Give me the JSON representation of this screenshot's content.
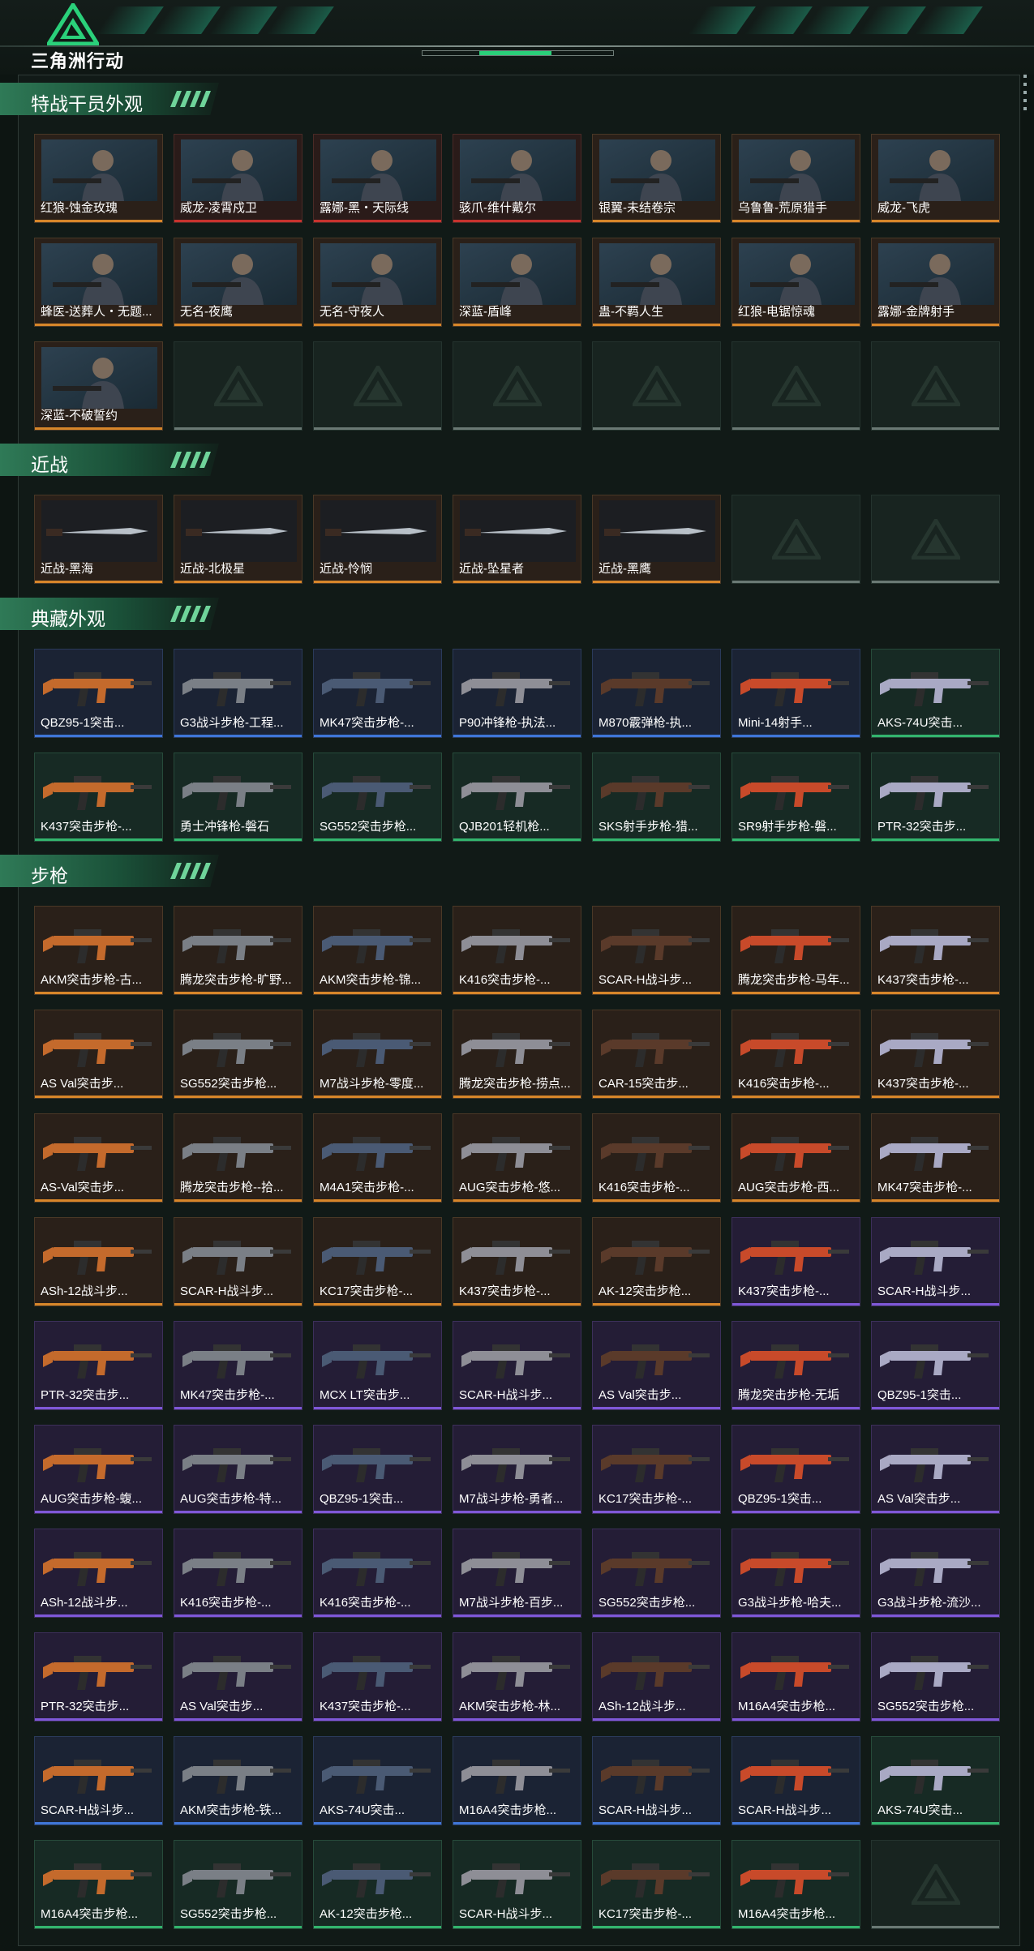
{
  "header": {
    "logo_text": "三角洲行动",
    "progress_fraction": 0.38
  },
  "colors": {
    "accent_green": "#2ad07a",
    "orange": "#d8862a",
    "purple": "#7f58d8",
    "blue": "#3f76d8",
    "green": "#33b56e",
    "red": "#c8322e",
    "gold": "#d6a33a",
    "empty": "#6a7974"
  },
  "sections": [
    {
      "title": "特战干员外观",
      "items": [
        {
          "name": "红狼-蚀金玫瑰",
          "rarity": "orange",
          "type": "operator"
        },
        {
          "name": "威龙-凌霄戍卫",
          "rarity": "red",
          "type": "operator"
        },
        {
          "name": "露娜-黑・天际线",
          "rarity": "red",
          "type": "operator"
        },
        {
          "name": "骇爪-维什戴尔",
          "rarity": "red",
          "type": "operator"
        },
        {
          "name": "银翼-未结卷宗",
          "rarity": "orange",
          "type": "operator"
        },
        {
          "name": "乌鲁鲁-荒原猎手",
          "rarity": "orange",
          "type": "operator"
        },
        {
          "name": "威龙-飞虎",
          "rarity": "orange",
          "type": "operator"
        },
        {
          "name": "蜂医-送葬人・无题...",
          "rarity": "orange",
          "type": "operator"
        },
        {
          "name": "无名-夜鹰",
          "rarity": "orange",
          "type": "operator"
        },
        {
          "name": "无名-守夜人",
          "rarity": "orange",
          "type": "operator"
        },
        {
          "name": "深蓝-盾峰",
          "rarity": "orange",
          "type": "operator"
        },
        {
          "name": "蛊-不羁人生",
          "rarity": "orange",
          "type": "operator"
        },
        {
          "name": "红狼-电锯惊魂",
          "rarity": "orange",
          "type": "operator"
        },
        {
          "name": "露娜-金牌射手",
          "rarity": "orange",
          "type": "operator"
        },
        {
          "name": "深蓝-不破誓约",
          "rarity": "orange",
          "type": "operator"
        },
        {
          "name": "",
          "rarity": "empty"
        },
        {
          "name": "",
          "rarity": "empty"
        },
        {
          "name": "",
          "rarity": "empty"
        },
        {
          "name": "",
          "rarity": "empty"
        },
        {
          "name": "",
          "rarity": "empty"
        },
        {
          "name": "",
          "rarity": "empty"
        }
      ]
    },
    {
      "title": "近战",
      "items": [
        {
          "name": "近战-黑海",
          "rarity": "orange",
          "type": "melee"
        },
        {
          "name": "近战-北极星",
          "rarity": "orange",
          "type": "melee"
        },
        {
          "name": "近战-怜悯",
          "rarity": "orange",
          "type": "melee"
        },
        {
          "name": "近战-坠星者",
          "rarity": "orange",
          "type": "melee"
        },
        {
          "name": "近战-黑鹰",
          "rarity": "orange",
          "type": "melee"
        },
        {
          "name": "",
          "rarity": "empty"
        },
        {
          "name": "",
          "rarity": "empty"
        }
      ]
    },
    {
      "title": "典藏外观",
      "items": [
        {
          "name": "QBZ95-1突击...",
          "rarity": "blue",
          "type": "gun"
        },
        {
          "name": "G3战斗步枪-工程...",
          "rarity": "blue",
          "type": "gun"
        },
        {
          "name": "MK47突击步枪-...",
          "rarity": "blue",
          "type": "gun"
        },
        {
          "name": "P90冲锋枪-执法...",
          "rarity": "blue",
          "type": "gun"
        },
        {
          "name": "M870霰弹枪-执...",
          "rarity": "blue",
          "type": "gun"
        },
        {
          "name": "Mini-14射手...",
          "rarity": "blue",
          "type": "gun"
        },
        {
          "name": "AKS-74U突击...",
          "rarity": "green",
          "type": "gun"
        },
        {
          "name": "K437突击步枪-...",
          "rarity": "green",
          "type": "gun"
        },
        {
          "name": "勇士冲锋枪-磐石",
          "rarity": "green",
          "type": "gun"
        },
        {
          "name": "SG552突击步枪...",
          "rarity": "green",
          "type": "gun"
        },
        {
          "name": "QJB201轻机枪...",
          "rarity": "green",
          "type": "gun"
        },
        {
          "name": "SKS射手步枪-猎...",
          "rarity": "green",
          "type": "gun"
        },
        {
          "name": "SR9射手步枪-磐...",
          "rarity": "green",
          "type": "gun"
        },
        {
          "name": "PTR-32突击步...",
          "rarity": "green",
          "type": "gun"
        }
      ]
    },
    {
      "title": "步枪",
      "items": [
        {
          "name": "AKM突击步枪-古...",
          "rarity": "orange",
          "type": "gun"
        },
        {
          "name": "腾龙突击步枪-旷野...",
          "rarity": "orange",
          "type": "gun"
        },
        {
          "name": "AKM突击步枪-锦...",
          "rarity": "orange",
          "type": "gun"
        },
        {
          "name": "K416突击步枪-...",
          "rarity": "orange",
          "type": "gun"
        },
        {
          "name": "SCAR-H战斗步...",
          "rarity": "orange",
          "type": "gun"
        },
        {
          "name": "腾龙突击步枪-马年...",
          "rarity": "orange",
          "type": "gun"
        },
        {
          "name": "K437突击步枪-...",
          "rarity": "orange",
          "type": "gun"
        },
        {
          "name": "AS Val突击步...",
          "rarity": "orange",
          "type": "gun"
        },
        {
          "name": "SG552突击步枪...",
          "rarity": "orange",
          "type": "gun"
        },
        {
          "name": "M7战斗步枪-零度...",
          "rarity": "orange",
          "type": "gun"
        },
        {
          "name": "腾龙突击步枪-捞点...",
          "rarity": "orange",
          "type": "gun"
        },
        {
          "name": "CAR-15突击步...",
          "rarity": "orange",
          "type": "gun"
        },
        {
          "name": "K416突击步枪-...",
          "rarity": "orange",
          "type": "gun"
        },
        {
          "name": "K437突击步枪-...",
          "rarity": "orange",
          "type": "gun"
        },
        {
          "name": "AS-Val突击步...",
          "rarity": "orange",
          "type": "gun"
        },
        {
          "name": "腾龙突击步枪--拾...",
          "rarity": "orange",
          "type": "gun"
        },
        {
          "name": "M4A1突击步枪-...",
          "rarity": "orange",
          "type": "gun"
        },
        {
          "name": "AUG突击步枪-悠...",
          "rarity": "orange",
          "type": "gun"
        },
        {
          "name": "K416突击步枪-...",
          "rarity": "orange",
          "type": "gun"
        },
        {
          "name": "AUG突击步枪-西...",
          "rarity": "orange",
          "type": "gun"
        },
        {
          "name": "MK47突击步枪-...",
          "rarity": "orange",
          "type": "gun"
        },
        {
          "name": "ASh-12战斗步...",
          "rarity": "orange",
          "type": "gun"
        },
        {
          "name": "SCAR-H战斗步...",
          "rarity": "orange",
          "type": "gun"
        },
        {
          "name": "KC17突击步枪-...",
          "rarity": "orange",
          "type": "gun"
        },
        {
          "name": "K437突击步枪-...",
          "rarity": "orange",
          "type": "gun"
        },
        {
          "name": "AK-12突击步枪...",
          "rarity": "orange",
          "type": "gun"
        },
        {
          "name": "K437突击步枪-...",
          "rarity": "purple",
          "type": "gun"
        },
        {
          "name": "SCAR-H战斗步...",
          "rarity": "purple",
          "type": "gun"
        },
        {
          "name": "PTR-32突击步...",
          "rarity": "purple",
          "type": "gun"
        },
        {
          "name": "MK47突击步枪-...",
          "rarity": "purple",
          "type": "gun"
        },
        {
          "name": "MCX LT突击步...",
          "rarity": "purple",
          "type": "gun"
        },
        {
          "name": "SCAR-H战斗步...",
          "rarity": "purple",
          "type": "gun"
        },
        {
          "name": "AS Val突击步...",
          "rarity": "purple",
          "type": "gun"
        },
        {
          "name": "腾龙突击步枪-无垢",
          "rarity": "purple",
          "type": "gun"
        },
        {
          "name": "QBZ95-1突击...",
          "rarity": "purple",
          "type": "gun"
        },
        {
          "name": "AUG突击步枪-蝮...",
          "rarity": "purple",
          "type": "gun"
        },
        {
          "name": "AUG突击步枪-特...",
          "rarity": "purple",
          "type": "gun"
        },
        {
          "name": "QBZ95-1突击...",
          "rarity": "purple",
          "type": "gun"
        },
        {
          "name": "M7战斗步枪-勇者...",
          "rarity": "purple",
          "type": "gun"
        },
        {
          "name": "KC17突击步枪-...",
          "rarity": "purple",
          "type": "gun"
        },
        {
          "name": "QBZ95-1突击...",
          "rarity": "purple",
          "type": "gun"
        },
        {
          "name": "AS Val突击步...",
          "rarity": "purple",
          "type": "gun"
        },
        {
          "name": "ASh-12战斗步...",
          "rarity": "purple",
          "type": "gun"
        },
        {
          "name": "K416突击步枪-...",
          "rarity": "purple",
          "type": "gun"
        },
        {
          "name": "K416突击步枪-...",
          "rarity": "purple",
          "type": "gun"
        },
        {
          "name": "M7战斗步枪-百步...",
          "rarity": "purple",
          "type": "gun"
        },
        {
          "name": "SG552突击步枪...",
          "rarity": "purple",
          "type": "gun"
        },
        {
          "name": "G3战斗步枪-哈夫...",
          "rarity": "purple",
          "type": "gun"
        },
        {
          "name": "G3战斗步枪-流沙...",
          "rarity": "purple",
          "type": "gun"
        },
        {
          "name": "PTR-32突击步...",
          "rarity": "purple",
          "type": "gun"
        },
        {
          "name": "AS Val突击步...",
          "rarity": "purple",
          "type": "gun"
        },
        {
          "name": "K437突击步枪-...",
          "rarity": "purple",
          "type": "gun"
        },
        {
          "name": "AKM突击步枪-林...",
          "rarity": "purple",
          "type": "gun"
        },
        {
          "name": "ASh-12战斗步...",
          "rarity": "purple",
          "type": "gun"
        },
        {
          "name": "M16A4突击步枪...",
          "rarity": "purple",
          "type": "gun"
        },
        {
          "name": "SG552突击步枪...",
          "rarity": "purple",
          "type": "gun"
        },
        {
          "name": "SCAR-H战斗步...",
          "rarity": "blue",
          "type": "gun"
        },
        {
          "name": "AKM突击步枪-铁...",
          "rarity": "blue",
          "type": "gun"
        },
        {
          "name": "AKS-74U突击...",
          "rarity": "blue",
          "type": "gun"
        },
        {
          "name": "M16A4突击步枪...",
          "rarity": "blue",
          "type": "gun"
        },
        {
          "name": "SCAR-H战斗步...",
          "rarity": "blue",
          "type": "gun"
        },
        {
          "name": "SCAR-H战斗步...",
          "rarity": "blue",
          "type": "gun"
        },
        {
          "name": "AKS-74U突击...",
          "rarity": "green",
          "type": "gun"
        },
        {
          "name": "M16A4突击步枪...",
          "rarity": "green",
          "type": "gun"
        },
        {
          "name": "SG552突击步枪...",
          "rarity": "green",
          "type": "gun"
        },
        {
          "name": "AK-12突击步枪...",
          "rarity": "green",
          "type": "gun"
        },
        {
          "name": "SCAR-H战斗步...",
          "rarity": "green",
          "type": "gun"
        },
        {
          "name": "KC17突击步枪-...",
          "rarity": "green",
          "type": "gun"
        },
        {
          "name": "M16A4突击步枪...",
          "rarity": "green",
          "type": "gun"
        },
        {
          "name": "",
          "rarity": "empty"
        }
      ]
    }
  ]
}
